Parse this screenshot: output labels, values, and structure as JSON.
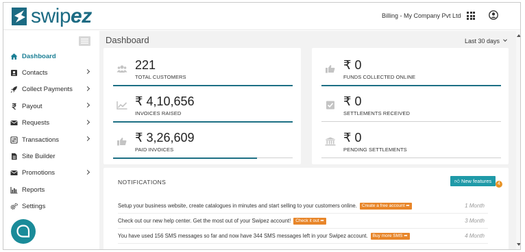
{
  "brand": {
    "logo_text_a": "swip",
    "logo_text_b": "ez"
  },
  "header": {
    "company": "Billing - My Company Pvt Ltd"
  },
  "sidebar": {
    "items": [
      {
        "label": "Dashboard",
        "icon": "home-icon",
        "active": true,
        "chevron": false
      },
      {
        "label": "Contacts",
        "icon": "contact-card-icon",
        "chevron": true
      },
      {
        "label": "Collect Payments",
        "icon": "rocket-icon",
        "chevron": true
      },
      {
        "label": "Payout",
        "icon": "rupee-icon",
        "chevron": true
      },
      {
        "label": "Requests",
        "icon": "envelope-icon",
        "chevron": true
      },
      {
        "label": "Transactions",
        "icon": "transfer-icon",
        "chevron": true
      },
      {
        "label": "Site Builder",
        "icon": "document-icon",
        "chevron": false
      },
      {
        "label": "Promotions",
        "icon": "envelope-icon",
        "chevron": true
      },
      {
        "label": "Reports",
        "icon": "bar-chart-icon",
        "chevron": false
      },
      {
        "label": "Settings",
        "icon": "gears-icon",
        "chevron": false
      }
    ]
  },
  "main": {
    "title": "Dashboard",
    "range": "Last 30 days",
    "left_stats": [
      {
        "value": "221",
        "label": "TOTAL CUSTOMERS",
        "icon": "users-icon",
        "progress": 1.0
      },
      {
        "value": "₹ 4,10,656",
        "label": "INVOICES RAISED",
        "icon": "trend-chart-icon",
        "progress": 1.0
      },
      {
        "value": "₹ 3,26,609",
        "label": "PAID INVOICES",
        "icon": "thumbs-up-icon",
        "progress": 0.8
      }
    ],
    "right_stats": [
      {
        "value": "₹ 0",
        "label": "FUNDS COLLECTED ONLINE",
        "icon": "thumbs-up-icon",
        "progress": 1.0
      },
      {
        "value": "₹ 0",
        "label": "SETTLEMENTS RECEIVED",
        "icon": "checkbox-icon",
        "progress": 0
      },
      {
        "value": "₹ 0",
        "label": "PENDING SETTLEMENTS",
        "icon": "bank-icon",
        "progress": 0
      }
    ],
    "notifications": {
      "title": "NOTIFICATIONS",
      "new_features_label": "New features",
      "new_features_count": "4",
      "rows": [
        {
          "text": "Setup your business website, create catalogues in minutes and start selling to your customers online.",
          "button": "Create a free account",
          "time": "1 Month"
        },
        {
          "text": "Check out our new help center. Get the most out of your Swipez account!",
          "button": "Check it out",
          "time": "3 Month"
        },
        {
          "text": "You have used 156 SMS messages so far and now have 344 SMS messages left in your Swipez account.",
          "button": "Buy more SMS",
          "time": "4 Month"
        }
      ]
    }
  },
  "colors": {
    "accent": "#1c6f84",
    "brand": "#1c6b83",
    "orange": "#e8862a",
    "teal": "#1f9aa8"
  }
}
